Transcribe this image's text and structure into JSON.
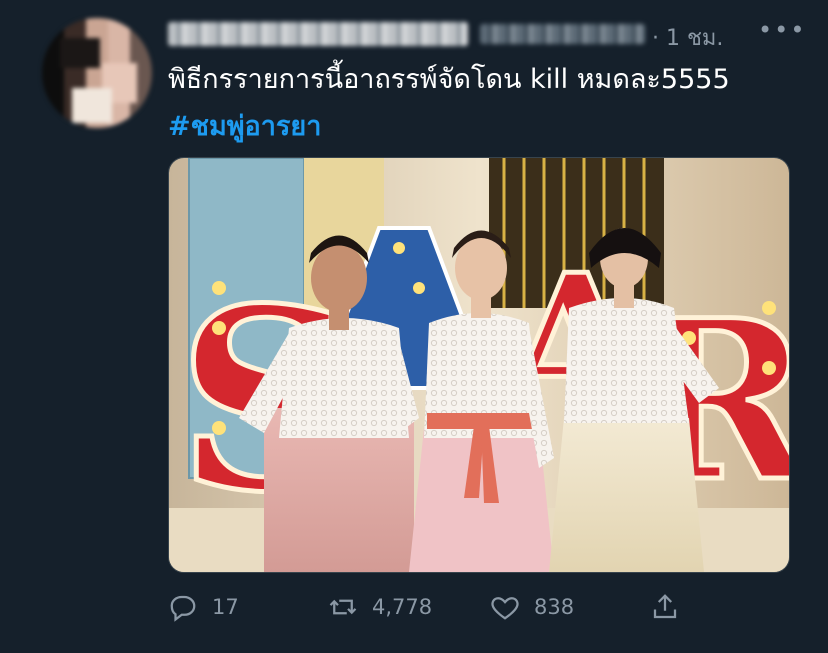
{
  "tweet": {
    "time": "· 1 ชม.",
    "more": "•••",
    "text": "พิธีกรรายการนี้อาถรรพ์จัดโดน kill หมดละ5555",
    "hashtag": "#ชมพู่อารยา",
    "image_sign_letters": [
      "S",
      "A",
      "R"
    ],
    "replies": "17",
    "retweets": "4,778",
    "likes": "838"
  },
  "colors": {
    "background": "#15202b",
    "secondary_text": "#8b98a5",
    "link": "#1d9bf0",
    "sign_red": "#d4272e"
  }
}
